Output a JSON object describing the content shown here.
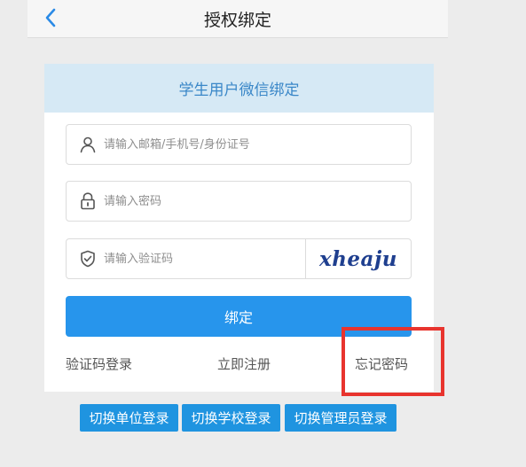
{
  "nav": {
    "title": "授权绑定",
    "back_icon": "chevron-left-icon"
  },
  "form": {
    "header": "学生用户微信绑定",
    "account": {
      "placeholder": "请输入邮箱/手机号/身份证号",
      "value": "",
      "icon": "user-icon"
    },
    "password": {
      "placeholder": "请输入密码",
      "value": "",
      "icon": "lock-icon"
    },
    "captcha": {
      "placeholder": "请输入验证码",
      "value": "",
      "icon": "shield-icon",
      "image_text": "xheaju"
    },
    "submit_label": "绑定",
    "links": {
      "sms_login": "验证码登录",
      "register": "立即注册",
      "forgot_password": "忘记密码"
    }
  },
  "switch_buttons": [
    {
      "label": "切换单位登录"
    },
    {
      "label": "切换学校登录"
    },
    {
      "label": "切换管理员登录"
    }
  ],
  "colors": {
    "accent": "#2795ec",
    "header_bg": "#d6e9f5",
    "header_text": "#3a87c8",
    "highlight": "#e8342e",
    "captcha_text": "#1f3f8f"
  }
}
